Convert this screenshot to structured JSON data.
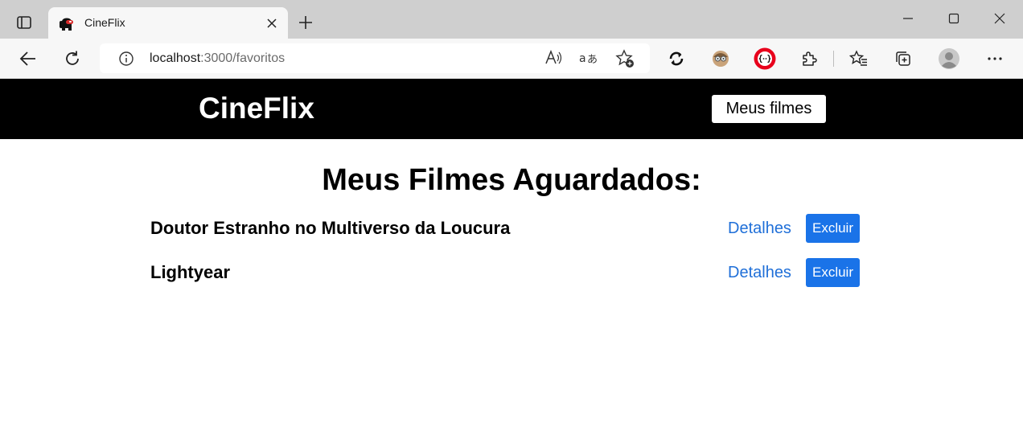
{
  "browser": {
    "tab": {
      "title": "CineFlix",
      "favicon": "among-us-icon"
    },
    "address": {
      "host": "localhost",
      "path": ":3000/favoritos"
    },
    "toolbar_icons": [
      "back-icon",
      "refresh-icon",
      "info-icon",
      "read-aloud-icon",
      "translate-icon",
      "add-favorite-icon",
      "sync-extension-icon",
      "avatar-extension-icon",
      "json-extension-icon",
      "extensions-icon",
      "favorites-icon",
      "collections-icon",
      "profile-icon",
      "more-icon"
    ],
    "colors": {
      "tabstrip": "#cfcfcf",
      "toolbar": "#f7f7f7",
      "extension_red": "#e8001c"
    }
  },
  "site": {
    "logo": "CineFlix",
    "nav_button": "Meus filmes",
    "page_title": "Meus Filmes Aguardados:",
    "movies": [
      {
        "name": "Doutor Estranho no Multiverso da Loucura",
        "details": "Detalhes",
        "delete": "Excluir"
      },
      {
        "name": "Lightyear",
        "details": "Detalhes",
        "delete": "Excluir"
      }
    ],
    "colors": {
      "header_bg": "#000000",
      "link": "#1f6fd8",
      "button_primary": "#1a73e8"
    }
  }
}
